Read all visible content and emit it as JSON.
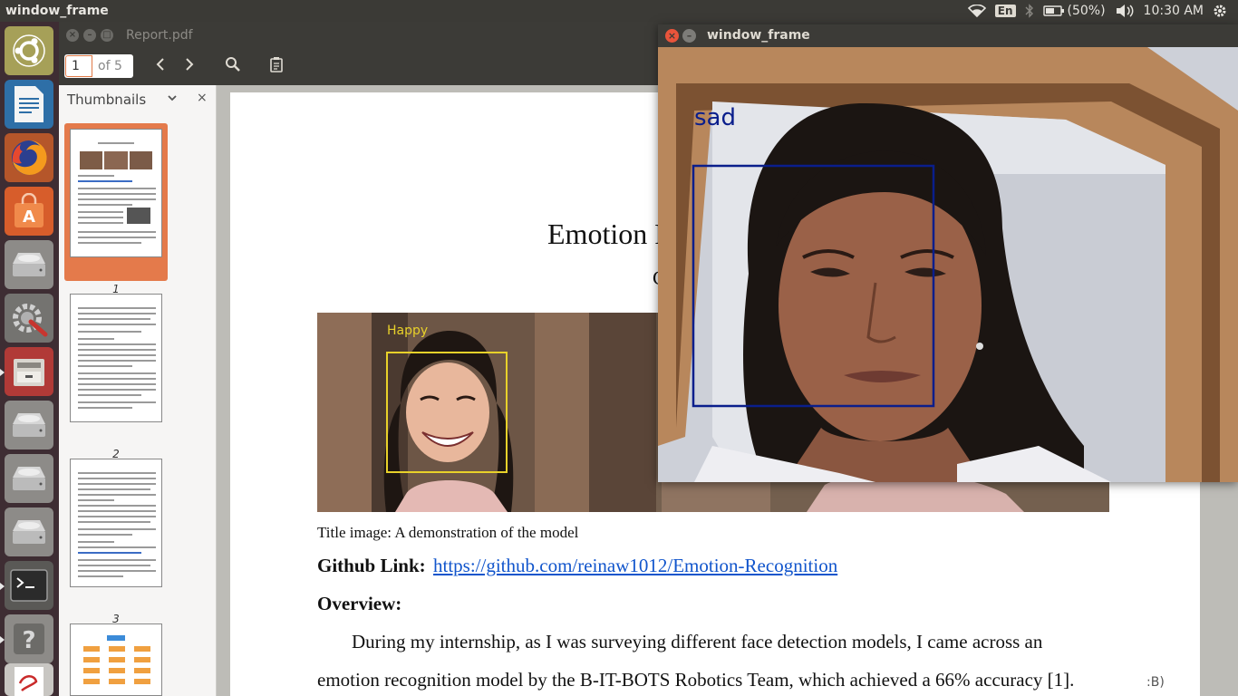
{
  "top_panel": {
    "app_title": "window_frame",
    "keyboard_layout": "En",
    "battery": "(50%)",
    "clock": "10:30 AM",
    "icons": [
      "wifi-icon",
      "bluetooth-icon",
      "battery-icon",
      "volume-icon",
      "settings-gear-icon"
    ]
  },
  "launcher": {
    "items": [
      "ubuntu-logo-icon",
      "libreoffice-writer-icon",
      "firefox-icon",
      "software-center-icon",
      "disk-icon",
      "system-settings-icon",
      "file-manager-icon",
      "disk-icon",
      "disk-icon",
      "disk-icon",
      "terminal-icon",
      "help-icon"
    ]
  },
  "viewer": {
    "title": "Report.pdf",
    "page_current": "1",
    "page_total": "of 5",
    "sidebar_title": "Thumbnails",
    "thumb_numbers": [
      "1",
      "2",
      "3"
    ],
    "document": {
      "title": "Emotion R",
      "subtitle": "C",
      "caption": "Title image: A demonstration of the model",
      "github_label": "Github Link:",
      "github_url": "https://github.com/reinaw1012/Emotion-Recognition",
      "overview_heading": "Overview:",
      "para_line1": "During my internship, as I was surveying different face detection models, I came across an",
      "para_line2": "emotion recognition model by the B-IT-BOTS Robotics Team, which achieved a 66% accuracy [1].",
      "hero_label": "Happy"
    },
    "edge_text": ":B)"
  },
  "cam_window": {
    "title": "window_frame",
    "emotion_label": "sad"
  }
}
